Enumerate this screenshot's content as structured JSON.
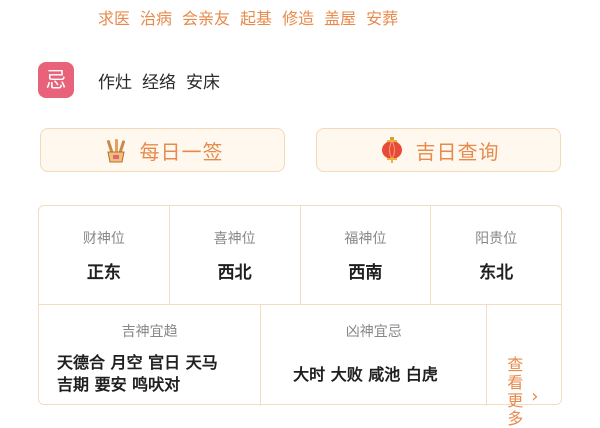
{
  "yi": {
    "items": [
      "求医",
      "治病",
      "会亲友",
      "起基",
      "修造",
      "盖屋",
      "安葬"
    ]
  },
  "ji": {
    "badge": "忌",
    "items": [
      "作灶",
      "经络",
      "安床"
    ]
  },
  "buttons": {
    "daily": "每日一签",
    "lucky": "吉日查询"
  },
  "directions": [
    {
      "title": "财神位",
      "value": "正东"
    },
    {
      "title": "喜神位",
      "value": "西北"
    },
    {
      "title": "福神位",
      "value": "西南"
    },
    {
      "title": "阳贵位",
      "value": "东北"
    }
  ],
  "gods": {
    "good_title": "吉神宜趋",
    "good_line1": "天德合 月空 官日 天马",
    "good_line2": "吉期 要安 鸣吠对",
    "bad_title": "凶神宜忌",
    "bad_line1": "大时 大败 咸池 白虎",
    "more_label": "查看更多"
  },
  "colors": {
    "accent": "#e88a4c",
    "ji_badge": "#e8627a",
    "border": "#f5dcc0",
    "button_bg": "#fff8ee"
  }
}
